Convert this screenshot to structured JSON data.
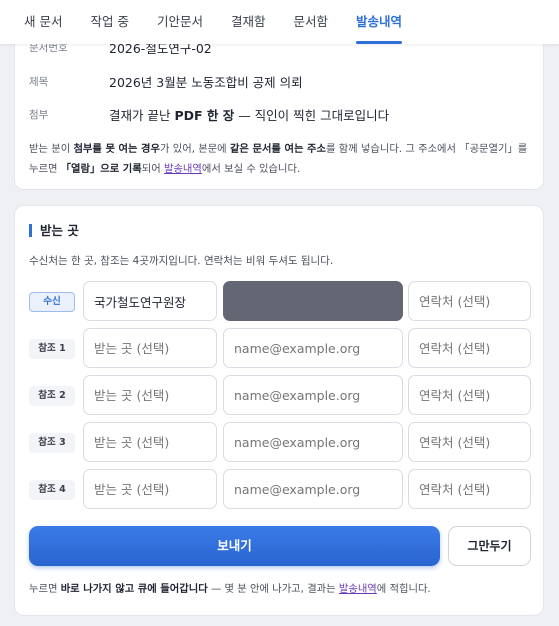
{
  "tabs": [
    {
      "label": "새 문서"
    },
    {
      "label": "작업 중"
    },
    {
      "label": "기안문서"
    },
    {
      "label": "결재함"
    },
    {
      "label": "문서함"
    },
    {
      "label": "발송내역",
      "active": true
    }
  ],
  "doc_info": {
    "docnum_key": "문서번호",
    "docnum_value": "2026-철도연구-02",
    "subject_key": "제목",
    "subject_value": "2026년 3월분 노동조합비 공제 의뢰",
    "attach_key": "첨부",
    "attach_pre": "결재가 끝난 ",
    "attach_bold": "PDF 한 장",
    "attach_post": " — 직인이 찍힌 그대로입니다",
    "note": {
      "p1": "받는 분이 ",
      "b1": "첨부를 못 여는 경우",
      "p2": "가 있어, 본문에 ",
      "b2": "같은 문서를 여는 주소",
      "p3": "를 함께 넣습니다. 그 주소에서 「공문열기」를 누르면 ",
      "b3": "「열람」으로 기록",
      "p4": "되어 ",
      "link": "발송내역",
      "p5": "에서 보실 수 있습니다."
    }
  },
  "recipients": {
    "title": "받는 곳",
    "desc": "수신처는 한 곳, 참조는 4곳까지입니다. 연락처는 비워 두셔도 됩니다.",
    "name_placeholder": "받는 곳 (선택)",
    "email_placeholder": "name@example.org",
    "phone_placeholder": "연락처 (선택)",
    "rows": [
      {
        "role": "수신",
        "name": "국가철도연구원장",
        "email": "",
        "phone": ""
      },
      {
        "role": "참조 1",
        "name": "",
        "email": "",
        "phone": ""
      },
      {
        "role": "참조 2",
        "name": "",
        "email": "",
        "phone": ""
      },
      {
        "role": "참조 3",
        "name": "",
        "email": "",
        "phone": ""
      },
      {
        "role": "참조 4",
        "name": "",
        "email": "",
        "phone": ""
      }
    ]
  },
  "actions": {
    "send": "보내기",
    "cancel": "그만두기"
  },
  "footnote": {
    "p1": "누르면 ",
    "bold": "바로 나가지 않고 큐에 들어갑니다",
    "p2": " — 몇 분 안에 나가고, 결과는 ",
    "link": "발송내역",
    "p3": "에 적힙니다."
  },
  "colors": {
    "accent": "#2f6fd6",
    "link": "#6a3bb8",
    "masked": "#636773"
  }
}
